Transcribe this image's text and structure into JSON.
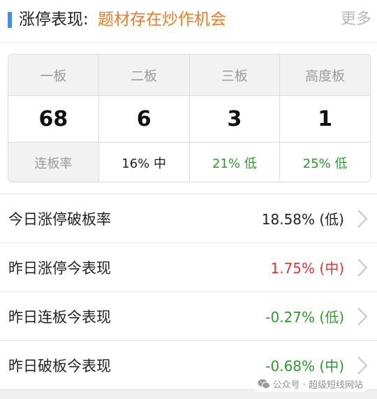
{
  "header": {
    "title": "涨停表现:",
    "subtitle": "题材存在炒作机会",
    "more": "更多"
  },
  "grid": {
    "headers": [
      "一板",
      "二板",
      "三板",
      "高度板"
    ],
    "counts": [
      "68",
      "6",
      "3",
      "1"
    ],
    "rate_label": "连板率",
    "rates": [
      {
        "text": "16% 中",
        "tone": "neutral"
      },
      {
        "text": "21% 低",
        "tone": "green"
      },
      {
        "text": "25% 低",
        "tone": "green"
      }
    ]
  },
  "list": [
    {
      "label": "今日涨停破板率",
      "value": "18.58% (低)",
      "tone": "neutral"
    },
    {
      "label": "昨日涨停今表现",
      "value": "1.75% (中)",
      "tone": "red"
    },
    {
      "label": "昨日连板今表现",
      "value": "-0.27% (低)",
      "tone": "green"
    },
    {
      "label": "昨日破板今表现",
      "value": "-0.68% (中)",
      "tone": "green"
    }
  ],
  "watermark": {
    "text": "公众号 · 超级短线网站",
    "icon": "wechat-icon"
  },
  "colors": {
    "accent": "#3d8ff0",
    "subtitle": "#f07d1e",
    "green": "#2e9a2e",
    "red": "#e03a3a",
    "neutral": "#222222"
  }
}
